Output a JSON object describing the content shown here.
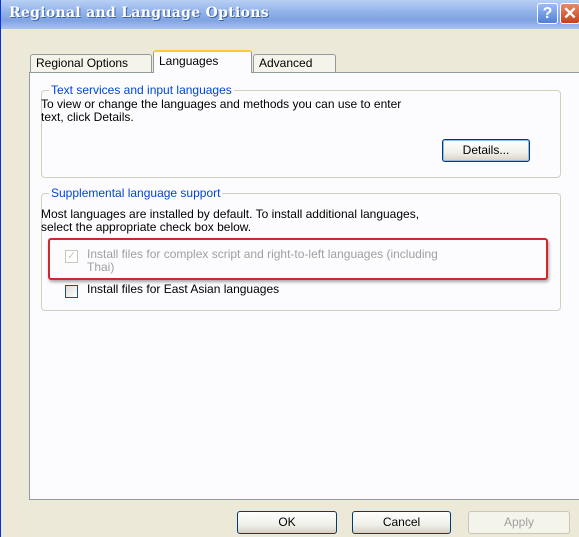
{
  "window": {
    "title": "Regional and Language Options",
    "help_glyph": "?",
    "close_glyph": "✕"
  },
  "tabs": [
    {
      "label": "Regional Options",
      "active": false
    },
    {
      "label": "Languages",
      "active": true
    },
    {
      "label": "Advanced",
      "active": false
    }
  ],
  "text_services": {
    "legend": "Text services and input languages",
    "description_line1": "To view or change the languages and methods you can use to enter",
    "description_line2": "text, click Details.",
    "details_button": "Details..."
  },
  "supplemental": {
    "legend": "Supplemental language support",
    "description_line1": "Most languages are installed by default. To install additional languages,",
    "description_line2": "select the appropriate check box below.",
    "complex_script": {
      "label_line1": "Install files for complex script and right-to-left languages (including",
      "label_line2": "Thai)",
      "checked": true,
      "enabled": false,
      "check_glyph": "✓"
    },
    "east_asian": {
      "label": "Install files for East Asian languages",
      "checked": false,
      "enabled": true
    }
  },
  "footer": {
    "ok": "OK",
    "cancel": "Cancel",
    "apply": "Apply"
  },
  "colors": {
    "legend_text": "#0046d5",
    "highlight_box": "#cc2a2a",
    "active_tab_accent": "#ffc83c"
  }
}
